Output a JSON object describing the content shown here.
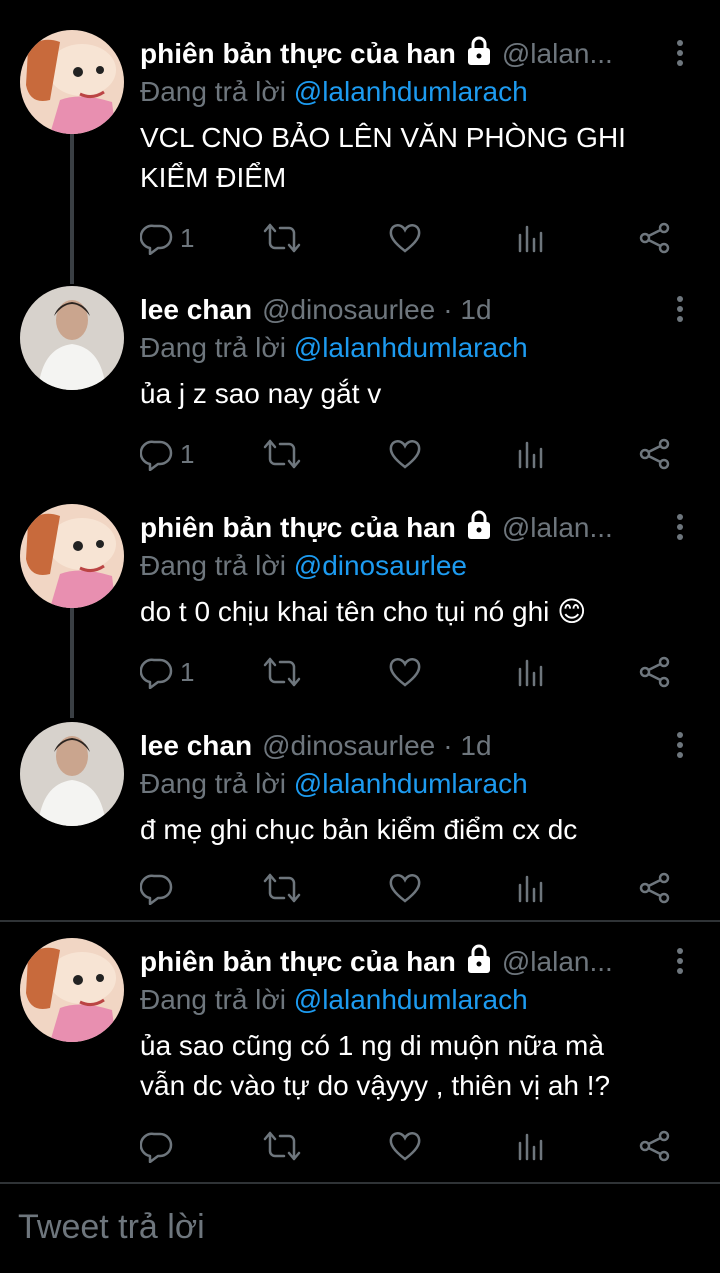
{
  "colors": {
    "background": "#000000",
    "muted": "#6e767d",
    "link": "#1d9bf0",
    "divider": "#2f3336"
  },
  "tweets": [
    {
      "name": "phiên bản thực của han",
      "locked": true,
      "handle": "@lalan...",
      "time": "",
      "reply_label": "Đang trả lời",
      "reply_to": "@lalanhdumlarach",
      "lines": [
        "VCL CNO BẢO LÊN VĂN PHÒNG GHI",
        "KIỂM ĐIỂM"
      ],
      "reply_count": "1"
    },
    {
      "name": "lee chan",
      "locked": false,
      "handle": "@dinosaurlee",
      "time": "· 1d",
      "reply_label": "Đang trả lời",
      "reply_to": "@lalanhdumlarach",
      "lines": [
        "ủa j z sao nay gắt v"
      ],
      "reply_count": "1"
    },
    {
      "name": "phiên bản thực của han",
      "locked": true,
      "handle": "@lalan...",
      "time": "",
      "reply_label": "Đang trả lời",
      "reply_to": "@dinosaurlee",
      "lines": [
        "do t 0 chịu khai tên cho tụi nó ghi 😊"
      ],
      "reply_count": "1"
    },
    {
      "name": "lee chan",
      "locked": false,
      "handle": "@dinosaurlee",
      "time": "· 1d",
      "reply_label": "Đang trả lời",
      "reply_to": "@lalanhdumlarach",
      "lines": [
        "đ mẹ ghi chục bản kiểm điểm cx dc"
      ],
      "reply_count": ""
    },
    {
      "name": "phiên bản thực của han",
      "locked": true,
      "handle": "@lalan...",
      "time": "",
      "reply_label": "Đang trả lời",
      "reply_to": "@lalanhdumlarach",
      "lines": [
        "ủa sao cũng có 1 ng di muộn  nữa mà",
        "vẫn dc vào tự do vậyyy , thiên vị ah !?"
      ],
      "reply_count": ""
    }
  ],
  "composer": {
    "placeholder": "Tweet trả lời"
  },
  "icons": [
    "reply-icon",
    "retweet-icon",
    "like-icon",
    "analytics-icon",
    "share-icon",
    "lock-icon",
    "more-icon"
  ]
}
